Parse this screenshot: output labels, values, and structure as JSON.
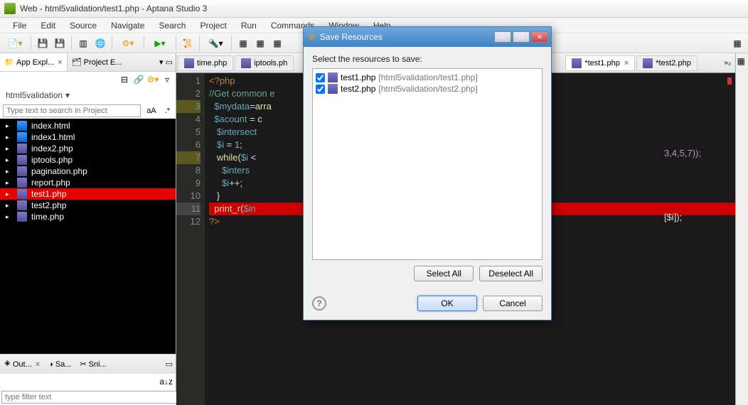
{
  "window": {
    "title": "Web - html5validation/test1.php - Aptana Studio 3"
  },
  "menu": [
    "File",
    "Edit",
    "Source",
    "Navigate",
    "Search",
    "Project",
    "Run",
    "Commands",
    "Window",
    "Help"
  ],
  "view_tabs": {
    "app_explorer": "App Expl...",
    "project_explorer": "Project E..."
  },
  "breadcrumb": "html5validation",
  "search_placeholder": "Type text to search in Project",
  "files": [
    {
      "name": "index.html",
      "type": "html"
    },
    {
      "name": "index1.html",
      "type": "html"
    },
    {
      "name": "index2.php",
      "type": "php"
    },
    {
      "name": "iptools.php",
      "type": "php"
    },
    {
      "name": "pagination.php",
      "type": "php"
    },
    {
      "name": "report.php",
      "type": "php"
    },
    {
      "name": "test1.php",
      "type": "php",
      "selected": true
    },
    {
      "name": "test2.php",
      "type": "php"
    },
    {
      "name": "time.php",
      "type": "php"
    }
  ],
  "bottom_tabs": {
    "outline": "Out...",
    "samples": "Sa...",
    "snippets": "Sni..."
  },
  "filter_placeholder": "type filter text",
  "editor_tabs": [
    {
      "label": "time.php",
      "dirty": false
    },
    {
      "label": "iptools.ph",
      "dirty": false
    },
    {
      "label": "*test1.php",
      "dirty": true,
      "active": true
    },
    {
      "label": "*test2.php",
      "dirty": true
    }
  ],
  "gutter_lines": [
    "1",
    "2",
    "3",
    "4",
    "5",
    "6",
    "7",
    "8",
    "9",
    "10",
    "11",
    "12"
  ],
  "code_lines": [
    {
      "html": "<span class='kw-tag'>&lt;?php</span>"
    },
    {
      "html": "<span class='kw-comment'>//Get common e</span>"
    },
    {
      "html": "  <span class='kw-var'>$mydata</span><span class='kw-plain'>=</span><span class='kw-fn'>arra</span>"
    },
    {
      "html": "  <span class='kw-var'>$acount</span> <span class='kw-plain'>= c</span>"
    },
    {
      "html": "   <span class='kw-var'>$intersect</span>"
    },
    {
      "html": "   <span class='kw-var'>$i</span> <span class='kw-plain'>=</span> <span class='kw-num'>1</span><span class='kw-plain'>;</span>"
    },
    {
      "html": "   <span class='kw-fn'>while</span><span class='kw-plain'>(</span><span class='kw-var'>$i</span> <span class='kw-plain'>&lt;</span>"
    },
    {
      "html": "     <span class='kw-var'>$inters</span>"
    },
    {
      "html": "     <span class='kw-var'>$i</span><span class='kw-plain'>++;</span>"
    },
    {
      "html": "   <span class='kw-plain'>}</span>"
    },
    {
      "html": "  <span class='kw-fn'>print_r</span><span class='kw-plain'>(</span><span class='kw-var'>$in</span>",
      "current": true
    },
    {
      "html": "<span class='kw-tag'>?&gt;</span>"
    }
  ],
  "right_code": {
    "l1": "3,4,5,7));",
    "l2": "[$i]);"
  },
  "dialog": {
    "title": "Save Resources",
    "prompt": "Select the resources to save:",
    "items": [
      {
        "name": "test1.php",
        "path": "[html5validation/test1.php]"
      },
      {
        "name": "test2.php",
        "path": "[html5validation/test2.php]"
      }
    ],
    "select_all": "Select All",
    "deselect_all": "Deselect All",
    "ok": "OK",
    "cancel": "Cancel"
  }
}
